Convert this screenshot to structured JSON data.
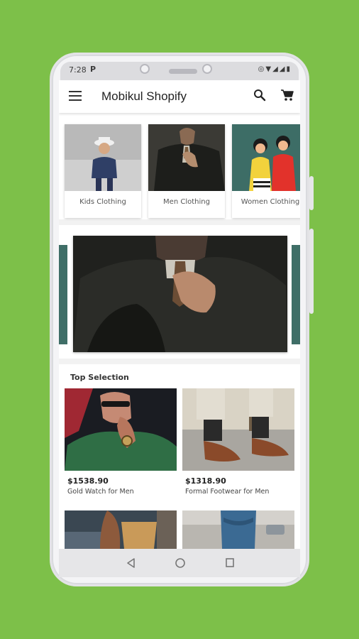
{
  "status_bar": {
    "time": "7:28",
    "notification_icon": "P",
    "icons": [
      "battery-saver-icon",
      "wifi-icon",
      "signal-icon",
      "signal-icon",
      "battery-icon"
    ]
  },
  "app_bar": {
    "title": "Mobikul Shopify",
    "icons": [
      "menu-icon",
      "search-icon",
      "cart-icon"
    ]
  },
  "categories": [
    {
      "label": "Kids Clothing"
    },
    {
      "label": "Men Clothing"
    },
    {
      "label": "Women Clothing"
    }
  ],
  "top_selection": {
    "title": "Top Selection",
    "products": [
      {
        "price": "$1538.90",
        "name": "Gold Watch for Men"
      },
      {
        "price": "$1318.90",
        "name": "Formal Footwear for Men"
      }
    ]
  },
  "nav_bar": {
    "icons": [
      "back-icon",
      "home-icon",
      "recents-icon"
    ]
  },
  "colors": {
    "background": "#7dc049",
    "banner_accent": "#3f6e67"
  }
}
